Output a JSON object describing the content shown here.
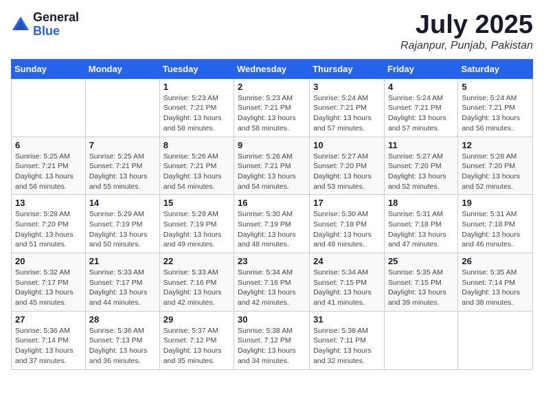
{
  "header": {
    "logo_general": "General",
    "logo_blue": "Blue",
    "month_title": "July 2025",
    "location": "Rajanpur, Punjab, Pakistan"
  },
  "weekdays": [
    "Sunday",
    "Monday",
    "Tuesday",
    "Wednesday",
    "Thursday",
    "Friday",
    "Saturday"
  ],
  "weeks": [
    [
      {
        "day": "",
        "detail": ""
      },
      {
        "day": "",
        "detail": ""
      },
      {
        "day": "1",
        "detail": "Sunrise: 5:23 AM\nSunset: 7:21 PM\nDaylight: 13 hours and 58 minutes."
      },
      {
        "day": "2",
        "detail": "Sunrise: 5:23 AM\nSunset: 7:21 PM\nDaylight: 13 hours and 58 minutes."
      },
      {
        "day": "3",
        "detail": "Sunrise: 5:24 AM\nSunset: 7:21 PM\nDaylight: 13 hours and 57 minutes."
      },
      {
        "day": "4",
        "detail": "Sunrise: 5:24 AM\nSunset: 7:21 PM\nDaylight: 13 hours and 57 minutes."
      },
      {
        "day": "5",
        "detail": "Sunrise: 5:24 AM\nSunset: 7:21 PM\nDaylight: 13 hours and 56 minutes."
      }
    ],
    [
      {
        "day": "6",
        "detail": "Sunrise: 5:25 AM\nSunset: 7:21 PM\nDaylight: 13 hours and 56 minutes."
      },
      {
        "day": "7",
        "detail": "Sunrise: 5:25 AM\nSunset: 7:21 PM\nDaylight: 13 hours and 55 minutes."
      },
      {
        "day": "8",
        "detail": "Sunrise: 5:26 AM\nSunset: 7:21 PM\nDaylight: 13 hours and 54 minutes."
      },
      {
        "day": "9",
        "detail": "Sunrise: 5:26 AM\nSunset: 7:21 PM\nDaylight: 13 hours and 54 minutes."
      },
      {
        "day": "10",
        "detail": "Sunrise: 5:27 AM\nSunset: 7:20 PM\nDaylight: 13 hours and 53 minutes."
      },
      {
        "day": "11",
        "detail": "Sunrise: 5:27 AM\nSunset: 7:20 PM\nDaylight: 13 hours and 52 minutes."
      },
      {
        "day": "12",
        "detail": "Sunrise: 5:28 AM\nSunset: 7:20 PM\nDaylight: 13 hours and 52 minutes."
      }
    ],
    [
      {
        "day": "13",
        "detail": "Sunrise: 5:28 AM\nSunset: 7:20 PM\nDaylight: 13 hours and 51 minutes."
      },
      {
        "day": "14",
        "detail": "Sunrise: 5:29 AM\nSunset: 7:19 PM\nDaylight: 13 hours and 50 minutes."
      },
      {
        "day": "15",
        "detail": "Sunrise: 5:29 AM\nSunset: 7:19 PM\nDaylight: 13 hours and 49 minutes."
      },
      {
        "day": "16",
        "detail": "Sunrise: 5:30 AM\nSunset: 7:19 PM\nDaylight: 13 hours and 48 minutes."
      },
      {
        "day": "17",
        "detail": "Sunrise: 5:30 AM\nSunset: 7:18 PM\nDaylight: 13 hours and 48 minutes."
      },
      {
        "day": "18",
        "detail": "Sunrise: 5:31 AM\nSunset: 7:18 PM\nDaylight: 13 hours and 47 minutes."
      },
      {
        "day": "19",
        "detail": "Sunrise: 5:31 AM\nSunset: 7:18 PM\nDaylight: 13 hours and 46 minutes."
      }
    ],
    [
      {
        "day": "20",
        "detail": "Sunrise: 5:32 AM\nSunset: 7:17 PM\nDaylight: 13 hours and 45 minutes."
      },
      {
        "day": "21",
        "detail": "Sunrise: 5:33 AM\nSunset: 7:17 PM\nDaylight: 13 hours and 44 minutes."
      },
      {
        "day": "22",
        "detail": "Sunrise: 5:33 AM\nSunset: 7:16 PM\nDaylight: 13 hours and 42 minutes."
      },
      {
        "day": "23",
        "detail": "Sunrise: 5:34 AM\nSunset: 7:16 PM\nDaylight: 13 hours and 42 minutes."
      },
      {
        "day": "24",
        "detail": "Sunrise: 5:34 AM\nSunset: 7:15 PM\nDaylight: 13 hours and 41 minutes."
      },
      {
        "day": "25",
        "detail": "Sunrise: 5:35 AM\nSunset: 7:15 PM\nDaylight: 13 hours and 39 minutes."
      },
      {
        "day": "26",
        "detail": "Sunrise: 5:35 AM\nSunset: 7:14 PM\nDaylight: 13 hours and 38 minutes."
      }
    ],
    [
      {
        "day": "27",
        "detail": "Sunrise: 5:36 AM\nSunset: 7:14 PM\nDaylight: 13 hours and 37 minutes."
      },
      {
        "day": "28",
        "detail": "Sunrise: 5:36 AM\nSunset: 7:13 PM\nDaylight: 13 hours and 36 minutes."
      },
      {
        "day": "29",
        "detail": "Sunrise: 5:37 AM\nSunset: 7:12 PM\nDaylight: 13 hours and 35 minutes."
      },
      {
        "day": "30",
        "detail": "Sunrise: 5:38 AM\nSunset: 7:12 PM\nDaylight: 13 hours and 34 minutes."
      },
      {
        "day": "31",
        "detail": "Sunrise: 5:38 AM\nSunset: 7:11 PM\nDaylight: 13 hours and 32 minutes."
      },
      {
        "day": "",
        "detail": ""
      },
      {
        "day": "",
        "detail": ""
      }
    ]
  ]
}
